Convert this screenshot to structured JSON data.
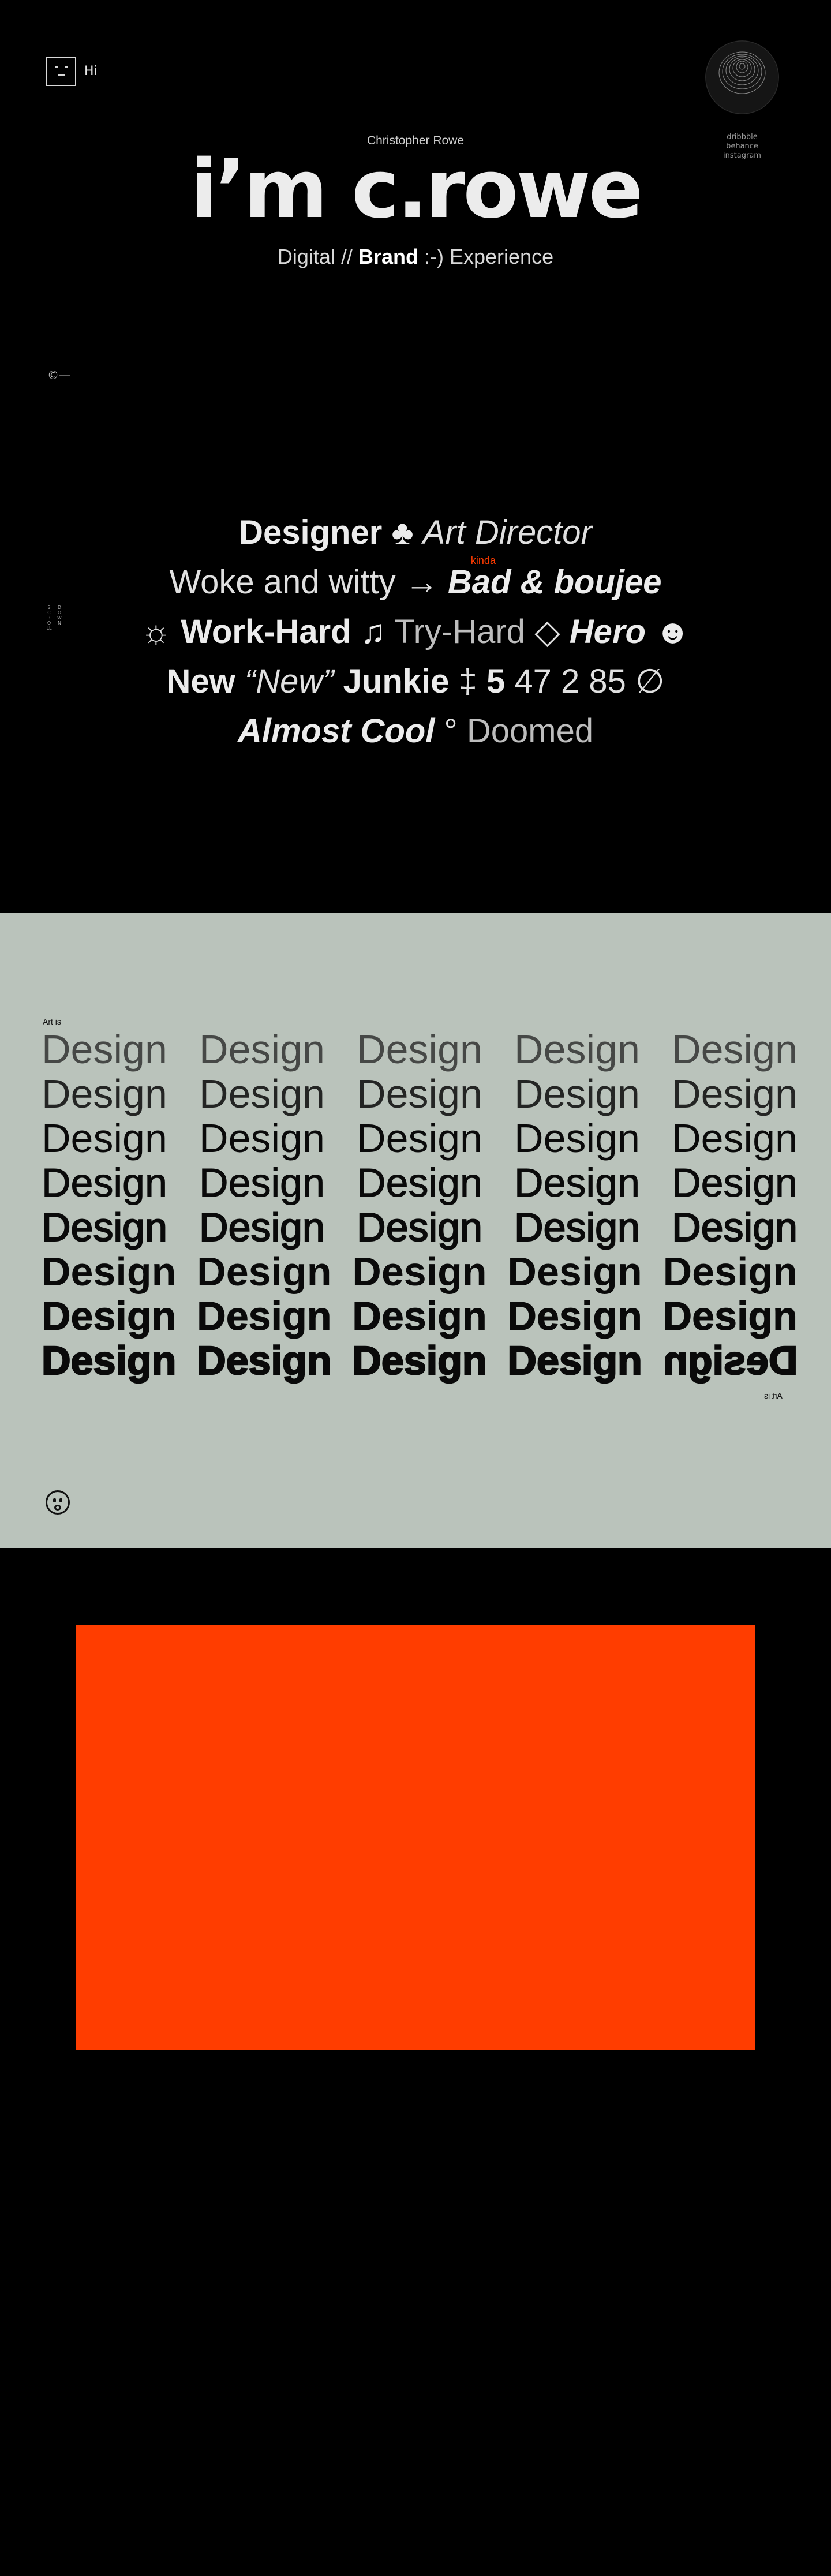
{
  "header": {
    "hi_label": "Hi",
    "social": [
      "dribbble",
      "behance",
      "instagram"
    ]
  },
  "hero": {
    "eyebrow": "Christopher Rowe",
    "title": "i’m c.rowe",
    "sub_pre": "Digital //",
    "sub_bold": "Brand",
    "sub_post": ":-) Experience",
    "copyright": "©—"
  },
  "side_note": {
    "col1": "SCROLL",
    "col2": "DOWN"
  },
  "manifesto": {
    "line1": {
      "a": "Designer",
      "sym": "♣",
      "b": "Art Director"
    },
    "line2": {
      "a": "Woke and witty",
      "sym": "→",
      "kinda": "kinda",
      "b": "Bad & boujee"
    },
    "line3": {
      "sun": "☼",
      "a": "Work-Hard",
      "note": "♫",
      "b": "Try-Hard",
      "diamond": "◇",
      "c": "Hero",
      "smile": "☻"
    },
    "line4": {
      "a": "New",
      "b": "“New”",
      "c": "Junkie",
      "d": "‡",
      "e": "5",
      "f": "47 2 85",
      "g": "∅"
    },
    "line5": {
      "a": "Almost Cool",
      "deg": "°",
      "b": "Doomed"
    }
  },
  "design_section": {
    "art_is": "Art is",
    "word": "Design",
    "art_is_mirrored": "Art is"
  },
  "colors": {
    "background": "#000000",
    "design_bg": "#bac3bb",
    "accent": "#ff3d00",
    "text": "#ececec"
  }
}
